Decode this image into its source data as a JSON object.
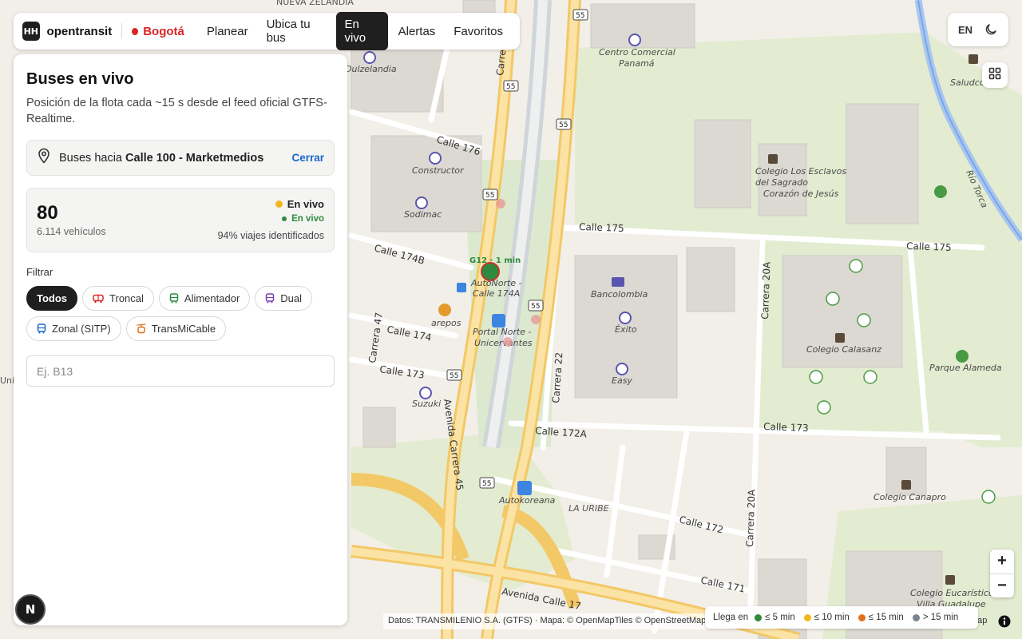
{
  "nav": {
    "brand_logo": "HH",
    "brand_name": "opentransit",
    "city": "Bogotá",
    "items": [
      {
        "label": "Planear",
        "active": false
      },
      {
        "label": "Ubica tu bus",
        "active": false
      },
      {
        "label": "En vivo",
        "active": true
      },
      {
        "label": "Alertas",
        "active": false
      },
      {
        "label": "Favoritos",
        "active": false
      }
    ]
  },
  "controls": {
    "lang": "EN",
    "theme_icon": "moon-icon",
    "layers_icon": "layers-icon"
  },
  "panel": {
    "title": "Buses en vivo",
    "description": "Posición de la flota cada ~15 s desde el feed oficial GTFS-Realtime.",
    "destination_prefix": "Buses hacia ",
    "destination_name": "Calle 100 - Marketmedios",
    "close_label": "Cerrar",
    "stats": {
      "count": "80",
      "vehicles": "6.114 vehículos",
      "live_main": "En vivo",
      "live_sub": "En vivo",
      "trips_identified": "94% viajes identificados"
    },
    "filter_label": "Filtrar",
    "chips": [
      {
        "label": "Todos",
        "active": true,
        "icon": ""
      },
      {
        "label": "Troncal",
        "active": false,
        "icon": "troncal-bus-icon",
        "color": "#d92626"
      },
      {
        "label": "Alimentador",
        "active": false,
        "icon": "alimentador-bus-icon",
        "color": "#2e8b3d"
      },
      {
        "label": "Dual",
        "active": false,
        "icon": "dual-bus-icon",
        "color": "#7b3fb5"
      },
      {
        "label": "Zonal (SITP)",
        "active": false,
        "icon": "zonal-bus-icon",
        "color": "#1c68c9"
      },
      {
        "label": "TransMiCable",
        "active": false,
        "icon": "cable-car-icon",
        "color": "#e0701b"
      }
    ],
    "search_placeholder": "Ej. B13"
  },
  "map": {
    "streets": [
      "Calle 176",
      "Calle 175",
      "Calle 175",
      "Calle 174B",
      "Calle 174",
      "Calle 173",
      "Calle 173",
      "Calle 172A",
      "Calle 172",
      "Calle 171",
      "Avenida Calle 17",
      "Carrera 47",
      "Avenida Carrera 45",
      "Carrera 22",
      "Carrera 20A",
      "Carrera 20A",
      "Carrera",
      "Río Torca",
      "LA URIBE"
    ],
    "places": [
      "Centro Comercial Panamá",
      "Dulzelandia",
      "Constructor",
      "Sodimac",
      "Bancolombia",
      "Éxito",
      "Easy",
      "Suzuki",
      "arepos",
      "Autokoreana",
      "AutoNorte - Calle 174A",
      "Portal Norte - Unicervantes",
      "Colegio Los Esclavos del Sagrado Corazón de Jesús",
      "Colegio Calasanz",
      "Parque Alameda",
      "Colegio Canapro",
      "Colegio Eucarístico Villa Guadalupe",
      "Saludco",
      "NUEVA ZELANDIA",
      "Univ"
    ],
    "shield": "55",
    "bus_marker": "G12 · 1 min",
    "bus_marker_color": "#2e8b3d"
  },
  "legend": {
    "title": "Llega en",
    "items": [
      {
        "label": "≤ 5 min",
        "color": "#2e8b3d"
      },
      {
        "label": "≤ 10 min",
        "color": "#f2b81b"
      },
      {
        "label": "≤ 15 min",
        "color": "#e0701b"
      },
      {
        "label": "> 15 min",
        "color": "#7a8591"
      }
    ]
  },
  "attribution": {
    "text": "Datos: TRANSMILENIO S.A. (GTFS) · Mapa: © OpenMapTiles © OpenStreetMap",
    "tail": "Map"
  },
  "zoom": {
    "in": "+",
    "out": "−"
  },
  "n_badge": "N"
}
